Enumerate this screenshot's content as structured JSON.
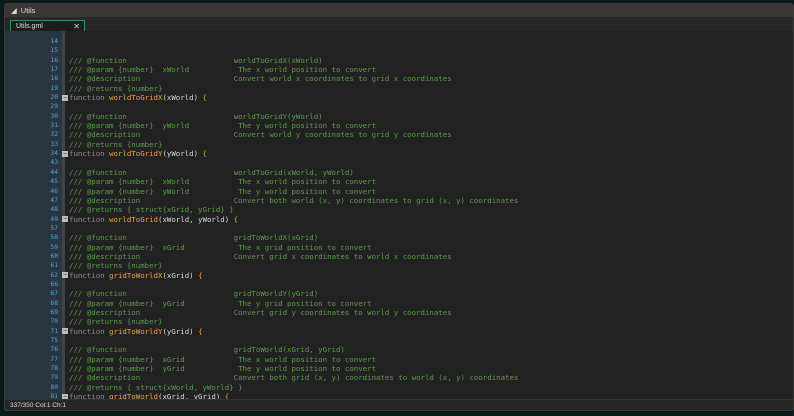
{
  "window": {
    "title": "Utils",
    "collapse_icon": "triangle-icon"
  },
  "tab": {
    "label": "Utils.gml",
    "close": "✕"
  },
  "status": "337/350 Col:1 Ch:1",
  "colors": {
    "comment": "#5c9a4d",
    "keyword": "#8a8a8a",
    "function_name": "#e8a24a",
    "line_number": "#4fa3d8"
  },
  "lines": [
    {
      "n": "14",
      "t": ""
    },
    {
      "n": "15",
      "t": ""
    },
    {
      "n": "16",
      "t": "/// @function                        worldToGridX(xWorld)",
      "k": "cm"
    },
    {
      "n": "17",
      "t": "/// @param {number}  xWorld           The x world position to convert",
      "k": "cm"
    },
    {
      "n": "18",
      "t": "/// @description                     Convert world x coordinates to grid x coordinates",
      "k": "cm"
    },
    {
      "n": "19",
      "t": "/// @returns {number}",
      "k": "cm"
    },
    {
      "n": "20",
      "kw": "function ",
      "fn": "worldToGridX",
      "pm": "(xWorld) ",
      "br": "{"
    },
    {
      "n": "29",
      "t": ""
    },
    {
      "n": "30",
      "t": "/// @function                        worldToGridY(yWorld)",
      "k": "cm"
    },
    {
      "n": "31",
      "t": "/// @param {number}  yWorld           The y world position to convert",
      "k": "cm"
    },
    {
      "n": "32",
      "t": "/// @description                     Convert world y coordinates to grid y coordinates",
      "k": "cm"
    },
    {
      "n": "33",
      "t": "/// @returns {number}",
      "k": "cm"
    },
    {
      "n": "34",
      "kw": "function ",
      "fn": "worldToGridY",
      "pm": "(yWorld) ",
      "br": "{"
    },
    {
      "n": "43",
      "t": ""
    },
    {
      "n": "44",
      "t": "/// @function                        worldToGrid(xWorld, yWorld)",
      "k": "cm"
    },
    {
      "n": "45",
      "t": "/// @param {number}  xWorld           The x world position to convert",
      "k": "cm"
    },
    {
      "n": "46",
      "t": "/// @param {number}  yWorld           The y world position to convert",
      "k": "cm"
    },
    {
      "n": "47",
      "t": "/// @description                     Convert both world (x, y) coordinates to grid (x, y) coordinates",
      "k": "cm"
    },
    {
      "n": "48",
      "t": "/// @returns { struct{xGrid, yGrid} }",
      "k": "cm"
    },
    {
      "n": "49",
      "kw": "function ",
      "fn": "worldToGrid",
      "pm": "(xWorld, yWorld) ",
      "br": "{"
    },
    {
      "n": "57",
      "t": ""
    },
    {
      "n": "58",
      "t": "/// @function                        gridToWorldX(xGrid)",
      "k": "cm"
    },
    {
      "n": "59",
      "t": "/// @param {number}  xGrid            The x grid position to convert",
      "k": "cm"
    },
    {
      "n": "60",
      "t": "/// @description                     Convert grid x coordinates to world x coordinates",
      "k": "cm"
    },
    {
      "n": "61",
      "t": "/// @returns {number}",
      "k": "cm"
    },
    {
      "n": "62",
      "kw": "function ",
      "fn": "gridToWorldX",
      "pm": "(xGrid) ",
      "br": "{"
    },
    {
      "n": "66",
      "t": ""
    },
    {
      "n": "67",
      "t": "/// @function                        gridToWorldY(yGrid)",
      "k": "cm"
    },
    {
      "n": "68",
      "t": "/// @param {number}  yGrid            The y grid position to convert",
      "k": "cm"
    },
    {
      "n": "69",
      "t": "/// @description                     Convert grid y coordinates to world y coordinates",
      "k": "cm"
    },
    {
      "n": "70",
      "t": "/// @returns {number}",
      "k": "cm"
    },
    {
      "n": "71",
      "kw": "function ",
      "fn": "gridToWorldY",
      "pm": "(yGrid) ",
      "br": "{"
    },
    {
      "n": "75",
      "t": ""
    },
    {
      "n": "76",
      "t": "/// @function                        gridToWorld(xGrid, yGrid)",
      "k": "cm"
    },
    {
      "n": "77",
      "t": "/// @param {number}  xGrid            The x world position to convert",
      "k": "cm"
    },
    {
      "n": "78",
      "t": "/// @param {number}  yGrid            The y world position to convert",
      "k": "cm"
    },
    {
      "n": "79",
      "t": "/// @description                     Convert both grid (x, y) coordinates to world (x, y) coordinates",
      "k": "cm"
    },
    {
      "n": "80",
      "t": "/// @returns { struct{xWorld, yWorld} }",
      "k": "cm"
    },
    {
      "n": "81",
      "kw": "function ",
      "fn": "gridToWorld",
      "pm": "(xGrid, yGrid) ",
      "br": "{"
    }
  ]
}
